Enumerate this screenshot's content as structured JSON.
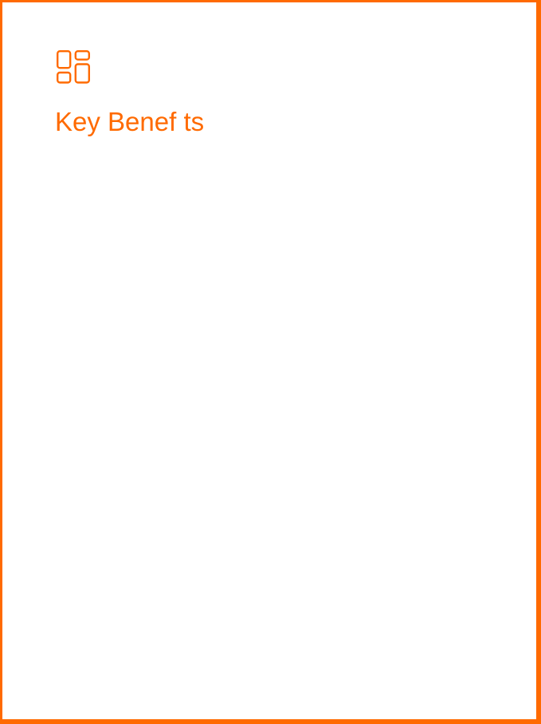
{
  "card": {
    "title": "Key Benef ts",
    "icon": "dashboard-layout-icon"
  },
  "colors": {
    "accent": "#ff6a00",
    "background": "#ffffff"
  }
}
